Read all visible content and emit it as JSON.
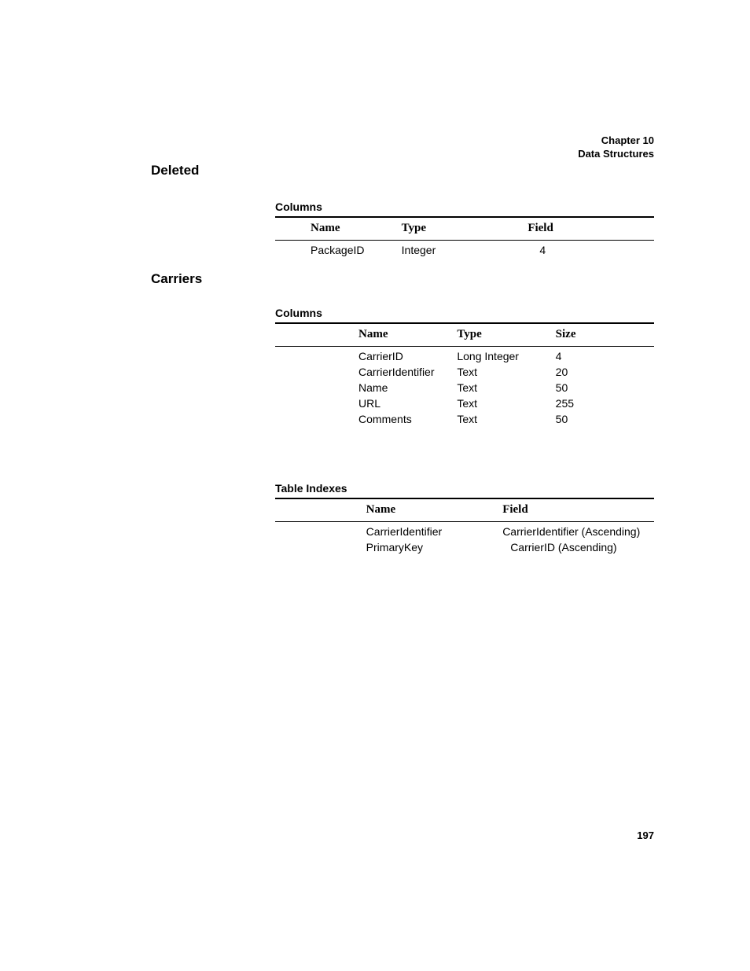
{
  "header": {
    "chapter": "Chapter 10",
    "title": "Data Structures"
  },
  "page_number": "197",
  "sections": {
    "deleted": {
      "heading": "Deleted",
      "columns": {
        "label": "Columns",
        "headers": {
          "name": "Name",
          "type": "Type",
          "field": "Field"
        },
        "rows": [
          {
            "name": "PackageID",
            "type": "Integer",
            "field": "4"
          }
        ]
      }
    },
    "carriers": {
      "heading": "Carriers",
      "columns": {
        "label": "Columns",
        "headers": {
          "name": "Name",
          "type": "Type",
          "size": "Size"
        },
        "rows": [
          {
            "name": "CarrierID",
            "type": "Long Integer",
            "size": "4"
          },
          {
            "name": "CarrierIdentifier",
            "type": "Text",
            "size": "20"
          },
          {
            "name": "Name",
            "type": "Text",
            "size": "50"
          },
          {
            "name": "URL",
            "type": "Text",
            "size": "255"
          },
          {
            "name": "Comments",
            "type": "Text",
            "size": "50"
          }
        ]
      },
      "indexes": {
        "label": "Table Indexes",
        "headers": {
          "name": "Name",
          "field": "Field"
        },
        "rows": [
          {
            "name": "CarrierIdentifier",
            "field": "CarrierIdentifier (Ascending)"
          },
          {
            "name": "PrimaryKey",
            "field": "CarrierID (Ascending)"
          }
        ]
      }
    }
  }
}
